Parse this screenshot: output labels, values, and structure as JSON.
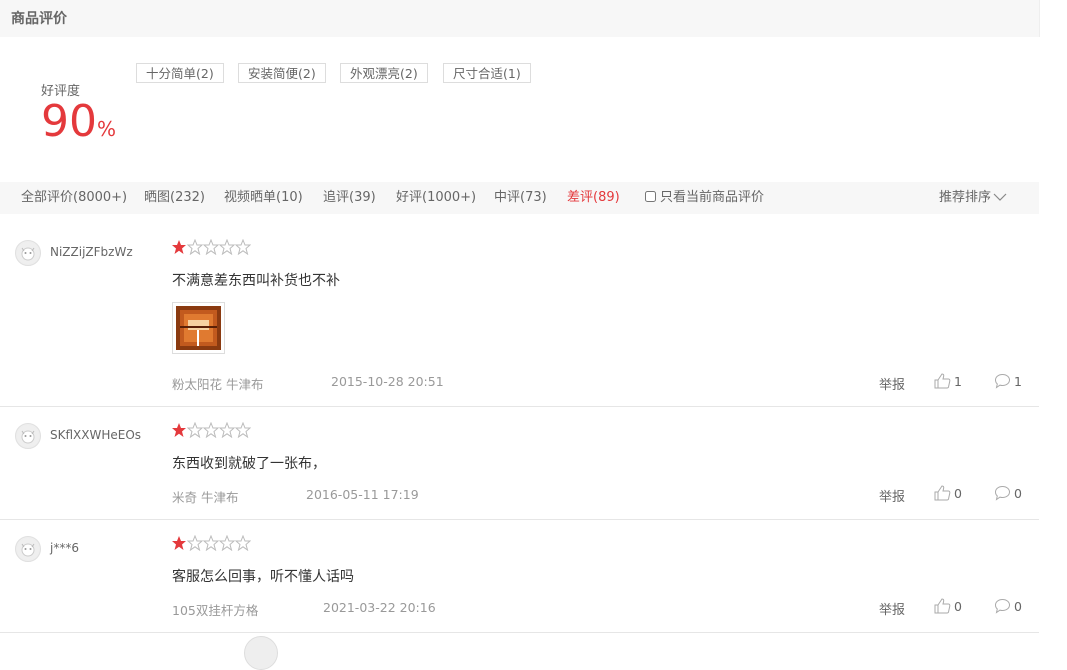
{
  "header": {
    "title": "商品评价"
  },
  "rating": {
    "label": "好评度",
    "value": "90",
    "unit": "%"
  },
  "tags": [
    {
      "label": "十分简单(2)"
    },
    {
      "label": "安装简便(2)"
    },
    {
      "label": "外观漂亮(2)"
    },
    {
      "label": "尺寸合适(1)"
    }
  ],
  "filters": [
    {
      "label": "全部评价(8000+)"
    },
    {
      "label": "晒图(232)"
    },
    {
      "label": "视频晒单(10)"
    },
    {
      "label": "追评(39)"
    },
    {
      "label": "好评(1000+)"
    },
    {
      "label": "中评(73)"
    },
    {
      "label": "差评(89)",
      "active": true
    }
  ],
  "only_current_label": "只看当前商品评价",
  "sort_label": "推荐排序",
  "report_label": "举报",
  "colors": {
    "accent": "#e4393c",
    "panel_bg": "#f7f7f7",
    "muted_text": "#999999"
  },
  "reviews": [
    {
      "user": "NiZZijZFbzWz",
      "stars": 1,
      "max_stars": 5,
      "content": "不满意差东西叫补货也不补",
      "has_image": true,
      "variant": "粉太阳花 牛津布",
      "date": "2015-10-28 20:51",
      "likes": "1",
      "replies": "1"
    },
    {
      "user": "SKflXXWHeEOs",
      "stars": 1,
      "max_stars": 5,
      "content": "东西收到就破了一张布，",
      "has_image": false,
      "variant": "米奇 牛津布",
      "date": "2016-05-11 17:19",
      "likes": "0",
      "replies": "0"
    },
    {
      "user": "j***6",
      "stars": 1,
      "max_stars": 5,
      "content": "客服怎么回事，听不懂人话吗",
      "has_image": false,
      "variant": "105双挂杆方格",
      "date": "2021-03-22 20:16",
      "likes": "0",
      "replies": "0"
    }
  ]
}
